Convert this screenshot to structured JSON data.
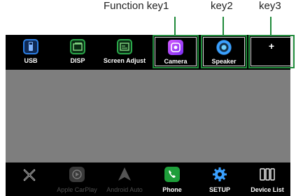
{
  "callouts": {
    "function_key1": "Function key1",
    "key2": "key2",
    "key3": "key3"
  },
  "top_tiles": [
    {
      "label": "USB",
      "icon": "usb-drive-icon"
    },
    {
      "label": "DISP",
      "icon": "display-icon"
    },
    {
      "label": "Screen Adjust",
      "icon": "screen-adjust-icon"
    },
    {
      "label": "Camera",
      "icon": "camera-app-icon"
    },
    {
      "label": "Speaker",
      "icon": "speaker-icon"
    },
    {
      "label": "+",
      "icon": "plus-icon"
    }
  ],
  "dock": [
    {
      "label": "",
      "icon": "close-x-icon"
    },
    {
      "label": "Apple CarPlay",
      "icon": "carplay-icon",
      "enabled": false
    },
    {
      "label": "Android Auto",
      "icon": "android-auto-icon",
      "enabled": false
    },
    {
      "label": "Phone",
      "icon": "phone-icon"
    },
    {
      "label": "SETUP",
      "icon": "gear-icon"
    },
    {
      "label": "Device List",
      "icon": "device-list-icon"
    }
  ],
  "colors": {
    "highlight": "#1f8a3a",
    "screen_bg": "#7e7e7e",
    "bar_bg": "#000000"
  }
}
